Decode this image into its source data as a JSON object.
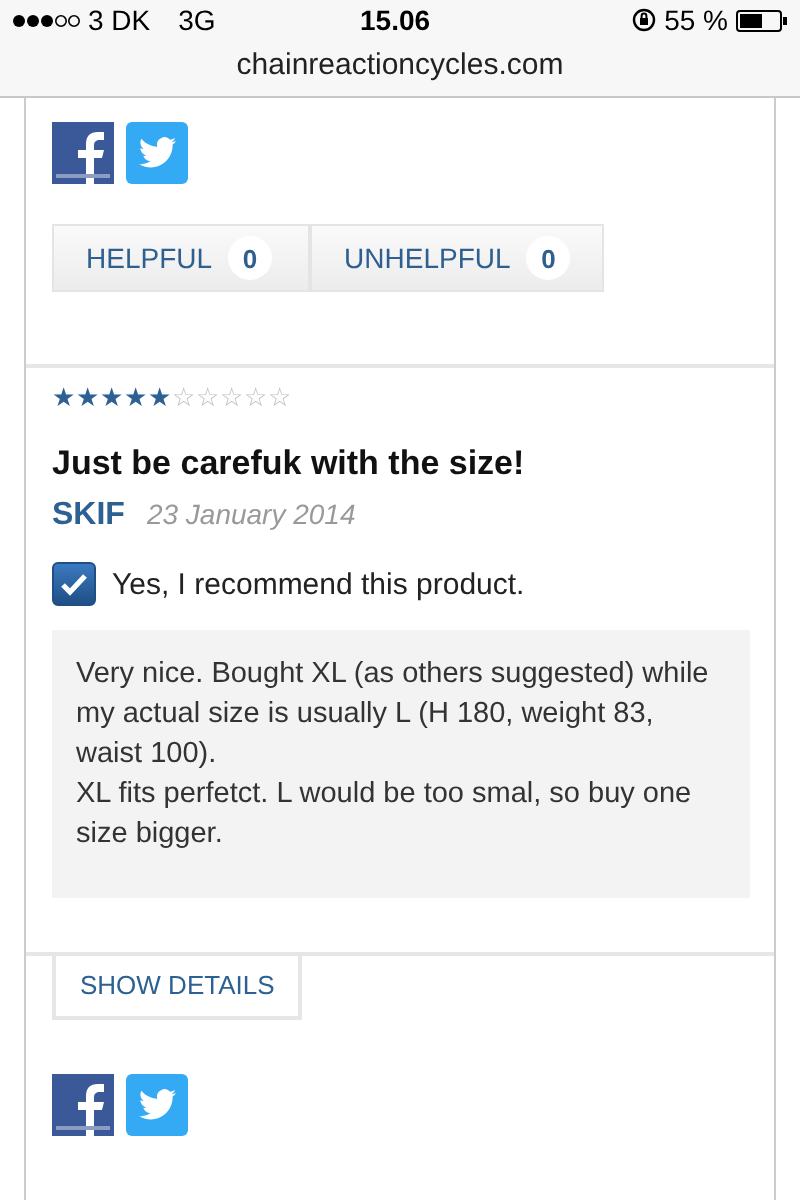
{
  "status_bar": {
    "carrier": "3 DK",
    "network": "3G",
    "time": "15.06",
    "battery": "55 %"
  },
  "address_bar": {
    "url": "chainreactioncycles.com"
  },
  "previous_review": {
    "votes": [
      {
        "label": "HELPFUL",
        "count": "0"
      },
      {
        "label": "UNHELPFUL",
        "count": "0"
      }
    ]
  },
  "review": {
    "stars": 5,
    "title": "Just be carefuk with the size!",
    "author": "SKIF",
    "date": "23 January 2014",
    "recommend": {
      "checked": true,
      "label": "Yes, I recommend this product."
    },
    "body": [
      "Very nice. Bought XL (as others suggested) while my actual size is usually L (H 180, weight 83, waist 100).",
      "XL fits perfetct. L would be too smal, so buy one size bigger."
    ],
    "details_button": "SHOW DETAILS"
  }
}
